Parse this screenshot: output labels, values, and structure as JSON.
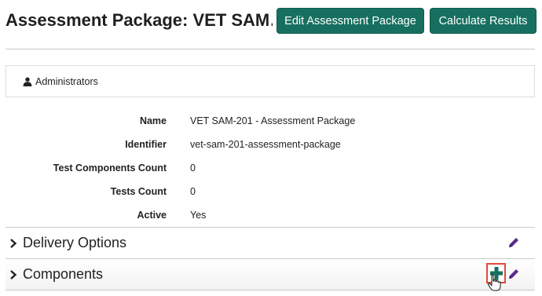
{
  "header": {
    "title": "Assessment Package: VET SAM…",
    "edit_button": "Edit Assessment Package",
    "calculate_button": "Calculate Results"
  },
  "admin_panel": {
    "label": "Administrators",
    "icon": "user-icon"
  },
  "details": [
    {
      "label": "Name",
      "value": "VET SAM-201 - Assessment Package"
    },
    {
      "label": "Identifier",
      "value": "vet-sam-201-assessment-package"
    },
    {
      "label": "Test Components Count",
      "value": "0"
    },
    {
      "label": "Tests Count",
      "value": "0"
    },
    {
      "label": "Active",
      "value": "Yes"
    }
  ],
  "sections": {
    "delivery_options": {
      "title": "Delivery Options",
      "icon": "pencil-icon"
    },
    "components": {
      "title": "Components",
      "add_icon": "plus-icon",
      "edit_icon": "pencil-icon"
    }
  },
  "colors": {
    "primary_button": "#17705f",
    "pencil": "#5a2b8f",
    "plus": "#17705f",
    "highlight": "#e04a3a"
  }
}
